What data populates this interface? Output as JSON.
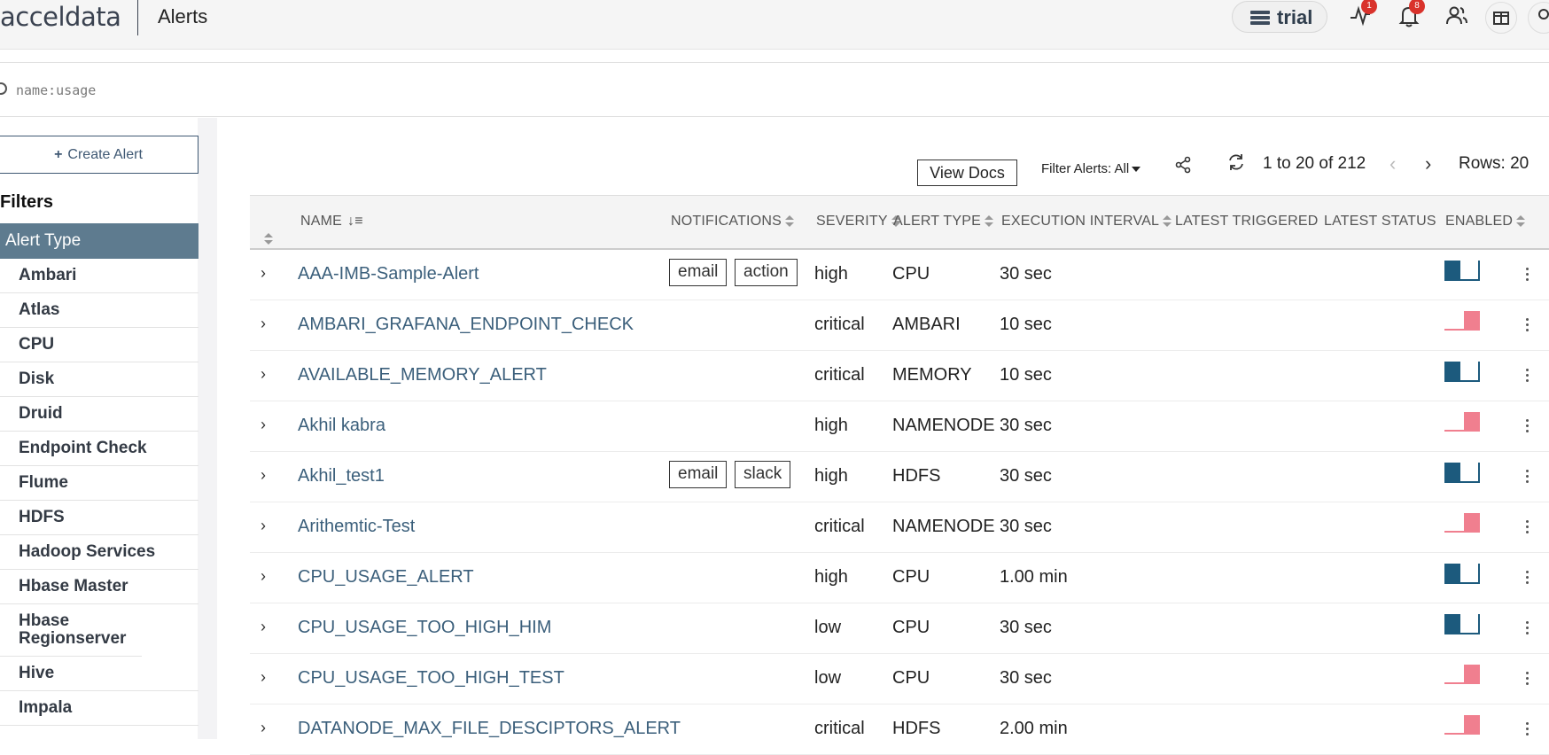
{
  "header": {
    "logo": "acceldata",
    "title": "Alerts",
    "plan_label": "trial",
    "activity_badge": "1",
    "notifications_badge": "8"
  },
  "search": {
    "placeholder": "name:usage"
  },
  "sidebar": {
    "create_label": "Create Alert",
    "filters_title": "Filters",
    "filter_group": "Alert Type",
    "items": [
      "Ambari",
      "Atlas",
      "CPU",
      "Disk",
      "Druid",
      "Endpoint Check",
      "Flume",
      "HDFS",
      "Hadoop Services",
      "Hbase Master",
      "Hbase Regionserver",
      "Hive",
      "Impala"
    ]
  },
  "toolbar": {
    "view_docs": "View Docs",
    "filter_label": "Filter Alerts: All",
    "pagination": "1 to 20 of 212",
    "rows_label": "Rows: 20"
  },
  "table": {
    "columns": {
      "name": "NAME",
      "notifications": "NOTIFICATIONS",
      "severity": "SEVERITY",
      "alert_type": "ALERT TYPE",
      "interval": "EXECUTION INTERVAL",
      "latest_triggered": "LATEST TRIGGERED",
      "latest_status": "LATEST STATUS",
      "enabled": "ENABLED"
    },
    "rows": [
      {
        "name": "AAA-IMB-Sample-Alert",
        "tags": [
          "email",
          "action"
        ],
        "severity": "high",
        "type": "CPU",
        "interval": "30 sec",
        "enabled": true
      },
      {
        "name": "AMBARI_GRAFANA_ENDPOINT_CHECK",
        "tags": [],
        "severity": "critical",
        "type": "AMBARI",
        "interval": "10 sec",
        "enabled": false
      },
      {
        "name": "AVAILABLE_MEMORY_ALERT",
        "tags": [],
        "severity": "critical",
        "type": "MEMORY",
        "interval": "10 sec",
        "enabled": true
      },
      {
        "name": "Akhil kabra",
        "tags": [],
        "severity": "high",
        "type": "NAMENODE",
        "interval": "30 sec",
        "enabled": false
      },
      {
        "name": "Akhil_test1",
        "tags": [
          "email",
          "slack"
        ],
        "severity": "high",
        "type": "HDFS",
        "interval": "30 sec",
        "enabled": true
      },
      {
        "name": "Arithemtic-Test",
        "tags": [],
        "severity": "critical",
        "type": "NAMENODE",
        "interval": "30 sec",
        "enabled": false
      },
      {
        "name": "CPU_USAGE_ALERT",
        "tags": [],
        "severity": "high",
        "type": "CPU",
        "interval": "1.00 min",
        "enabled": true
      },
      {
        "name": "CPU_USAGE_TOO_HIGH_HIM",
        "tags": [],
        "severity": "low",
        "type": "CPU",
        "interval": "30 sec",
        "enabled": true
      },
      {
        "name": "CPU_USAGE_TOO_HIGH_TEST",
        "tags": [],
        "severity": "low",
        "type": "CPU",
        "interval": "30 sec",
        "enabled": false
      },
      {
        "name": "DATANODE_MAX_FILE_DESCIPTORS_ALERT",
        "tags": [],
        "severity": "critical",
        "type": "HDFS",
        "interval": "2.00 min",
        "enabled": false
      }
    ]
  }
}
